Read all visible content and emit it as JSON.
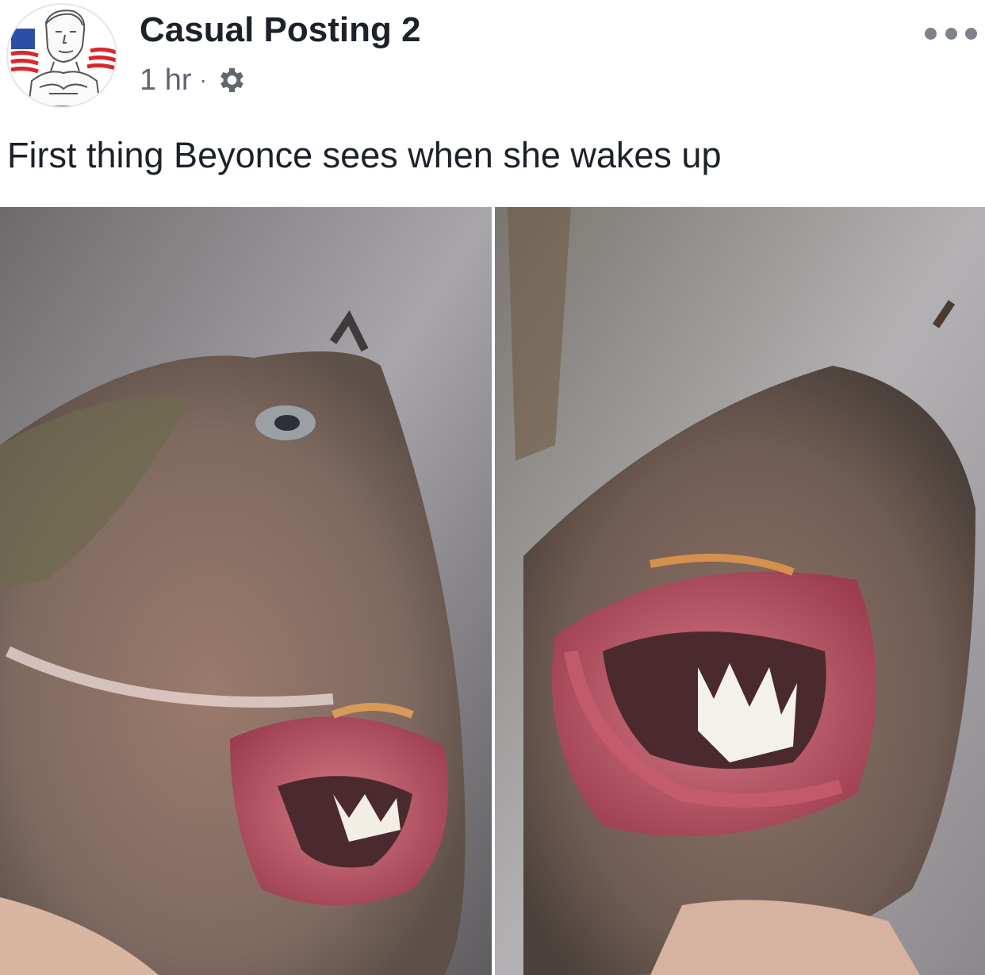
{
  "post": {
    "author_name": "Casual Posting 2",
    "timestamp": "1 hr",
    "separator": "·",
    "privacy_icon": "gear-icon",
    "more_icon": "more-options-icon",
    "caption": "First thing Beyonce sees when she wakes up"
  },
  "colors": {
    "text_primary": "#1d2129",
    "text_secondary": "#616770",
    "flag_red": "#d9262c",
    "flag_blue": "#2b4fa3"
  }
}
